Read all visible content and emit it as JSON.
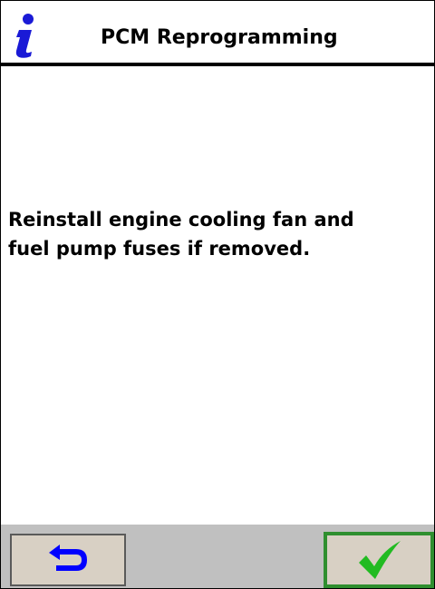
{
  "header": {
    "title": "PCM Reprogramming",
    "icon": "info-icon"
  },
  "message": {
    "line1": "Reinstall engine cooling fan and",
    "line2": "fuel pump fuses if removed."
  },
  "toolbar": {
    "back_icon": "return-arrow-icon",
    "ok_icon": "checkmark-icon"
  },
  "colors": {
    "info_icon": "#1a1ad6",
    "back_arrow": "#0000ff",
    "checkmark": "#22bb22",
    "ok_border": "#2f8f2f",
    "toolbar_bg": "#c0c0c0",
    "button_bg": "#d8d0c4"
  }
}
